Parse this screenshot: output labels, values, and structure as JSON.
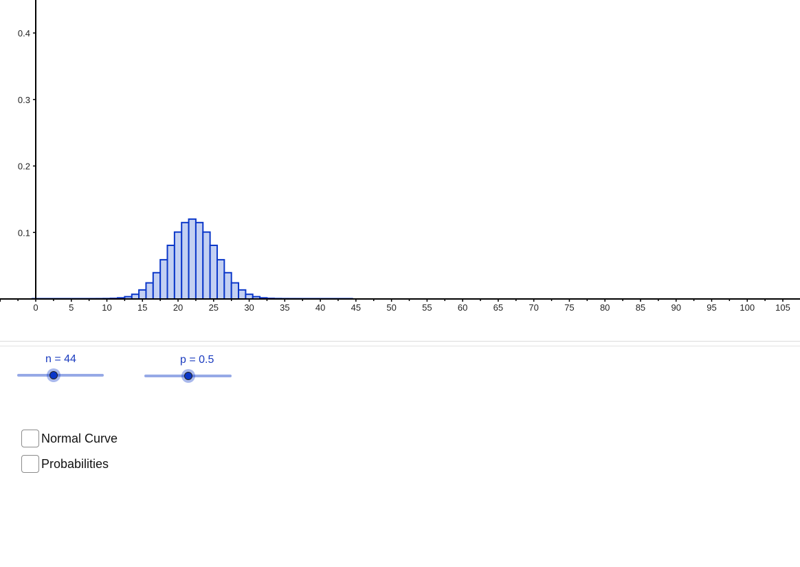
{
  "accent_color": "#0b37c9",
  "bar_fill": "#c3d0f2",
  "slider_track_color": "#96a9e6",
  "chart_data": {
    "type": "bar",
    "title": "",
    "xlabel": "",
    "ylabel": "",
    "distribution": "Binomial(n=44, p=0.5)",
    "xlim": [
      -5,
      108
    ],
    "ylim": [
      0,
      0.45
    ],
    "grid": false,
    "x_ticks": [
      "0",
      "5",
      "10",
      "15",
      "20",
      "25",
      "30",
      "35",
      "40",
      "45",
      "50",
      "55",
      "60",
      "65",
      "70",
      "75",
      "80",
      "85",
      "90",
      "95",
      "100",
      "105"
    ],
    "x_tick_values": [
      0,
      5,
      10,
      15,
      20,
      25,
      30,
      35,
      40,
      45,
      50,
      55,
      60,
      65,
      70,
      75,
      80,
      85,
      90,
      95,
      100,
      105
    ],
    "y_ticks": [
      "0.1",
      "0.2",
      "0.3",
      "0.4"
    ],
    "y_tick_values": [
      0.1,
      0.2,
      0.3,
      0.4
    ],
    "categories": [
      0,
      1,
      2,
      3,
      4,
      5,
      6,
      7,
      8,
      9,
      10,
      11,
      12,
      13,
      14,
      15,
      16,
      17,
      18,
      19,
      20,
      21,
      22,
      23,
      24,
      25,
      26,
      27,
      28,
      29,
      30,
      31,
      32,
      33,
      34,
      35,
      36,
      37,
      38,
      39,
      40,
      41,
      42,
      43,
      44
    ],
    "values": [
      0,
      0,
      0,
      0,
      0,
      0,
      0,
      2.5e-06,
      1.07e-05,
      4.13e-05,
      0.000142,
      0.000436,
      0.0012,
      0.00295,
      0.00654,
      0.0131,
      0.0237,
      0.039,
      0.0585,
      0.0801,
      0.1001,
      0.1144,
      0.1196,
      0.1144,
      0.1001,
      0.0801,
      0.0585,
      0.039,
      0.0237,
      0.0131,
      0.00654,
      0.00295,
      0.0012,
      0.000436,
      0.000142,
      4.13e-05,
      1.07e-05,
      2.5e-06,
      0,
      0,
      0,
      0,
      0,
      0,
      0
    ]
  },
  "sliders": [
    {
      "label": "n = 44",
      "name": "n",
      "value": 44,
      "min": 0,
      "max": 100,
      "fraction": 0.42
    },
    {
      "label": "p = 0.5",
      "name": "p",
      "value": 0.5,
      "min": 0,
      "max": 1,
      "fraction": 0.5
    }
  ],
  "checkboxes": [
    {
      "label": "Normal Curve",
      "checked": false
    },
    {
      "label": "Probabilities",
      "checked": false
    }
  ]
}
